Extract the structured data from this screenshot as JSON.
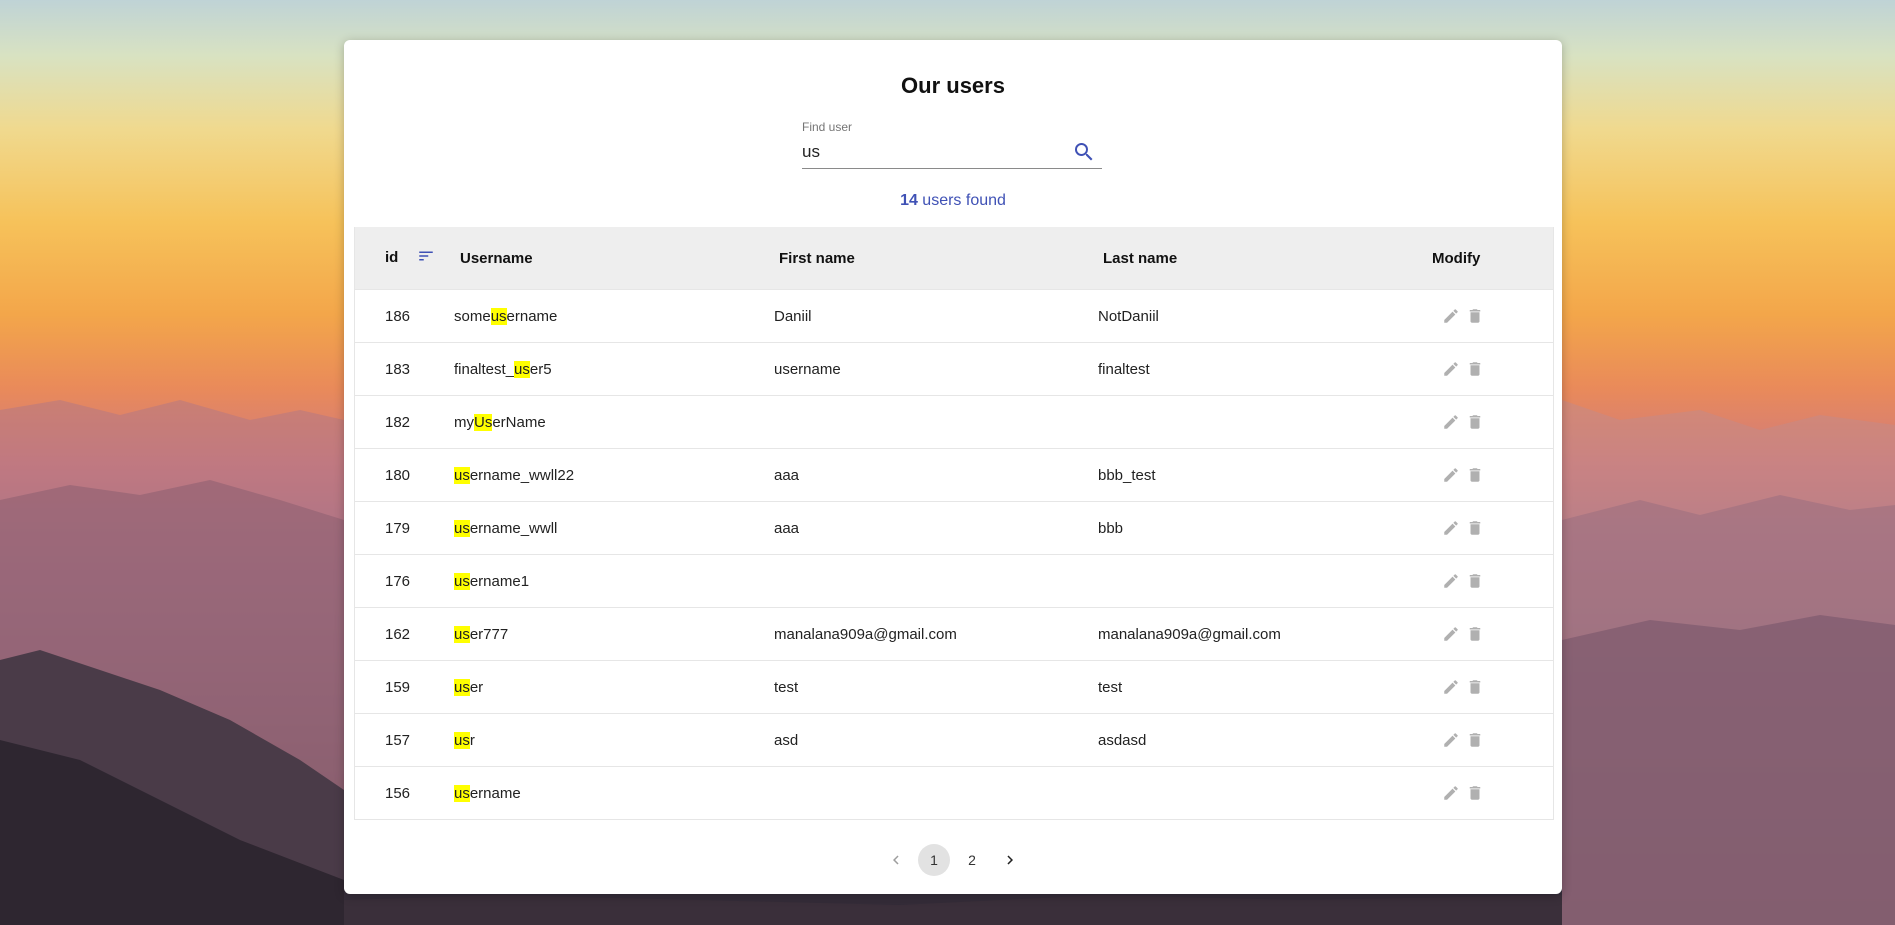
{
  "page": {
    "title": "Our users"
  },
  "search": {
    "label": "Find user",
    "value": "us",
    "icon": "search-icon"
  },
  "results": {
    "count": "14",
    "suffix": " users found"
  },
  "table": {
    "columns": {
      "id": "id",
      "username": "Username",
      "first_name": "First name",
      "last_name": "Last name",
      "modify": "Modify"
    },
    "highlight_color": "#ffff00",
    "rows": [
      {
        "id": "186",
        "username_pre": "some",
        "username_hl": "us",
        "username_post": "ername",
        "first_name": "Daniil",
        "last_name": "NotDaniil"
      },
      {
        "id": "183",
        "username_pre": "finaltest_",
        "username_hl": "us",
        "username_post": "er5",
        "first_name": "username",
        "last_name": "finaltest"
      },
      {
        "id": "182",
        "username_pre": "my",
        "username_hl": "Us",
        "username_post": "erName",
        "first_name": "",
        "last_name": ""
      },
      {
        "id": "180",
        "username_pre": "",
        "username_hl": "us",
        "username_post": "ername_wwll22",
        "first_name": "aaa",
        "last_name": "bbb_test"
      },
      {
        "id": "179",
        "username_pre": "",
        "username_hl": "us",
        "username_post": "ername_wwll",
        "first_name": "aaa",
        "last_name": "bbb"
      },
      {
        "id": "176",
        "username_pre": "",
        "username_hl": "us",
        "username_post": "ername1",
        "first_name": "",
        "last_name": ""
      },
      {
        "id": "162",
        "username_pre": "",
        "username_hl": "us",
        "username_post": "er777",
        "first_name": "manalana909a@gmail.com",
        "last_name": "manalana909a@gmail.com"
      },
      {
        "id": "159",
        "username_pre": "",
        "username_hl": "us",
        "username_post": "er",
        "first_name": "test",
        "last_name": "test"
      },
      {
        "id": "157",
        "username_pre": "",
        "username_hl": "us",
        "username_post": "r",
        "first_name": "asd",
        "last_name": "asdasd"
      },
      {
        "id": "156",
        "username_pre": "",
        "username_hl": "us",
        "username_post": "ername",
        "first_name": "",
        "last_name": ""
      }
    ]
  },
  "pagination": {
    "pages": [
      "1",
      "2"
    ],
    "current": "1"
  },
  "colors": {
    "accent": "#3f51b5",
    "header_bg": "#eeeeee",
    "icon_gray": "#9e9e9e"
  }
}
